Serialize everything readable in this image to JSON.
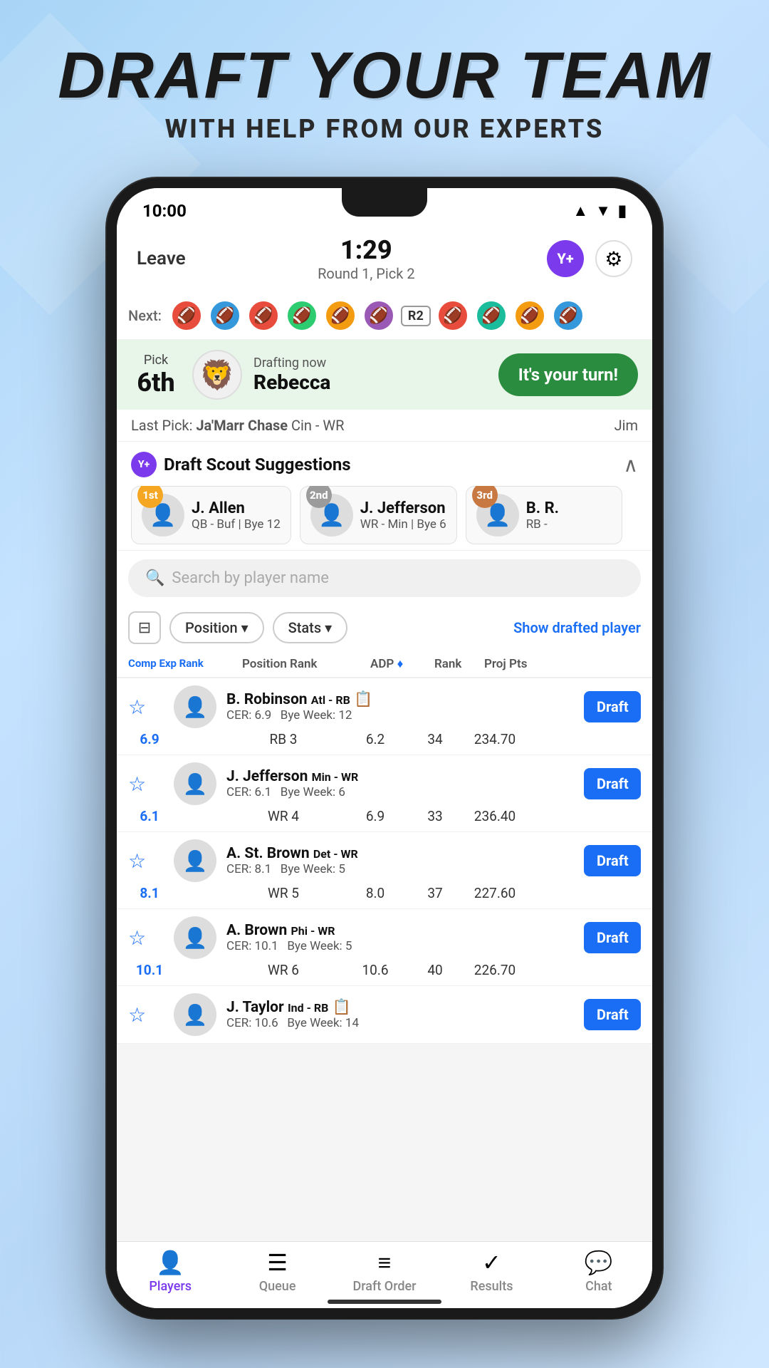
{
  "page": {
    "title": "DRAFT YOUR TEAM",
    "subtitle": "WITH HELP FROM OUR EXPERTS"
  },
  "status_bar": {
    "time": "10:00",
    "icons": "▲▼📶🔋"
  },
  "header": {
    "leave": "Leave",
    "timer": "1:29",
    "round_info": "Round 1, Pick 2",
    "yplus": "Y+",
    "gear": "⚙"
  },
  "draft_order": {
    "next_label": "Next:",
    "r2_label": "R2"
  },
  "pick_section": {
    "pick_label": "Pick",
    "pick_number": "6th",
    "drafting_label": "Drafting now",
    "drafter_name": "Rebecca",
    "your_turn": "It's your turn!"
  },
  "last_pick": {
    "label": "Last Pick:",
    "player": "Ja'Marr Chase",
    "team": "Cin - WR",
    "user": "Jim"
  },
  "scout": {
    "title": "Draft Scout Suggestions",
    "yplus": "Y+",
    "suggestions": [
      {
        "rank": "1st",
        "rank_class": "rank-gold",
        "name": "J. Allen",
        "position": "QB - Buf",
        "bye": "Bye 12",
        "emoji": "🏈"
      },
      {
        "rank": "2nd",
        "rank_class": "rank-silver",
        "name": "J. Jefferson",
        "position": "WR - Min",
        "bye": "Bye 6",
        "emoji": "🏈"
      },
      {
        "rank": "3rd",
        "rank_class": "rank-bronze",
        "name": "B. R.",
        "position": "RB -",
        "bye": "",
        "emoji": "🏈"
      }
    ]
  },
  "search": {
    "placeholder": "Search by player name"
  },
  "filters": {
    "position_label": "Position ▾",
    "stats_label": "Stats ▾",
    "show_drafted": "Show drafted player"
  },
  "table_header": {
    "comp_exp_rank": "Comp Exp Rank",
    "position_rank": "Position Rank",
    "adp": "ADP",
    "rank": "Rank",
    "proj_pts": "Proj Pts"
  },
  "players": [
    {
      "cer": "6.9",
      "name": "B. Robinson",
      "team": "Atl - RB",
      "cer_label": "CER: 6.9",
      "bye": "Bye Week: 12",
      "pos_rank": "RB 3",
      "adp": "6.2",
      "rank": "34",
      "proj_pts": "234.70",
      "emoji": "🏈",
      "draft_label": "Draft"
    },
    {
      "cer": "6.1",
      "name": "J. Jefferson",
      "team": "Min - WR",
      "cer_label": "CER: 6.1",
      "bye": "Bye Week: 6",
      "pos_rank": "WR 4",
      "adp": "6.9",
      "rank": "33",
      "proj_pts": "236.40",
      "emoji": "🏈",
      "draft_label": "Draft"
    },
    {
      "cer": "8.1",
      "name": "A. St. Brown",
      "team": "Det - WR",
      "cer_label": "CER: 8.1",
      "bye": "Bye Week: 5",
      "pos_rank": "WR 5",
      "adp": "8.0",
      "rank": "37",
      "proj_pts": "227.60",
      "emoji": "🏈",
      "draft_label": "Draft"
    },
    {
      "cer": "10.1",
      "name": "A. Brown",
      "team": "Phi - WR",
      "cer_label": "CER: 10.1",
      "bye": "Bye Week: 5",
      "pos_rank": "WR 6",
      "adp": "10.6",
      "rank": "40",
      "proj_pts": "226.70",
      "emoji": "🏈",
      "draft_label": "Draft"
    },
    {
      "cer": "10.6",
      "name": "J. Taylor",
      "team": "Ind - RB",
      "cer_label": "CER: 10.6",
      "bye": "Bye Week: 14",
      "pos_rank": "",
      "adp": "",
      "rank": "",
      "proj_pts": "",
      "emoji": "🏈",
      "draft_label": "Draft"
    }
  ],
  "bottom_nav": {
    "items": [
      {
        "icon": "👤",
        "label": "Players",
        "active": true
      },
      {
        "icon": "☰",
        "label": "Queue",
        "active": false
      },
      {
        "icon": "≡",
        "label": "Draft Order",
        "active": false
      },
      {
        "icon": "✓",
        "label": "Results",
        "active": false
      },
      {
        "icon": "💬",
        "label": "Chat",
        "active": false
      }
    ]
  }
}
